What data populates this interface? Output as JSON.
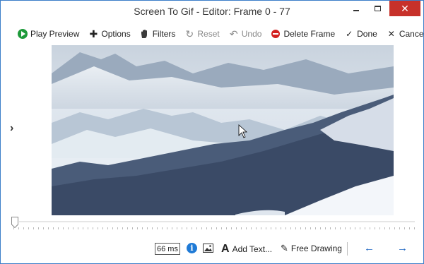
{
  "window": {
    "title": "Screen To Gif - Editor: Frame 0 - 77"
  },
  "toolbar": {
    "play_preview": "Play Preview",
    "options": "Options",
    "filters": "Filters",
    "reset": "Reset",
    "undo": "Undo",
    "delete_frame": "Delete Frame",
    "done": "Done",
    "cancel": "Cancel"
  },
  "bottombar": {
    "delay": "66 ms",
    "add_text": "Add Text...",
    "free_drawing": "Free Drawing"
  },
  "slider": {
    "value": 0
  },
  "icons": {
    "play": "play-icon",
    "options": "plus-icon",
    "filters": "hand-icon",
    "reset": "reset-icon",
    "undo": "undo-icon",
    "delete": "delete-icon",
    "done": "check-icon",
    "cancel": "close-icon",
    "info": "info-icon",
    "image": "image-icon",
    "text": "text-icon",
    "pen": "pen-icon",
    "prev": "arrow-left-icon",
    "next": "arrow-right-icon",
    "expand": "chevron-right-icon"
  },
  "colors": {
    "accent": "#1f66c2",
    "close": "#c7312a",
    "play": "#1e9a3a",
    "delete": "#d3201f"
  }
}
